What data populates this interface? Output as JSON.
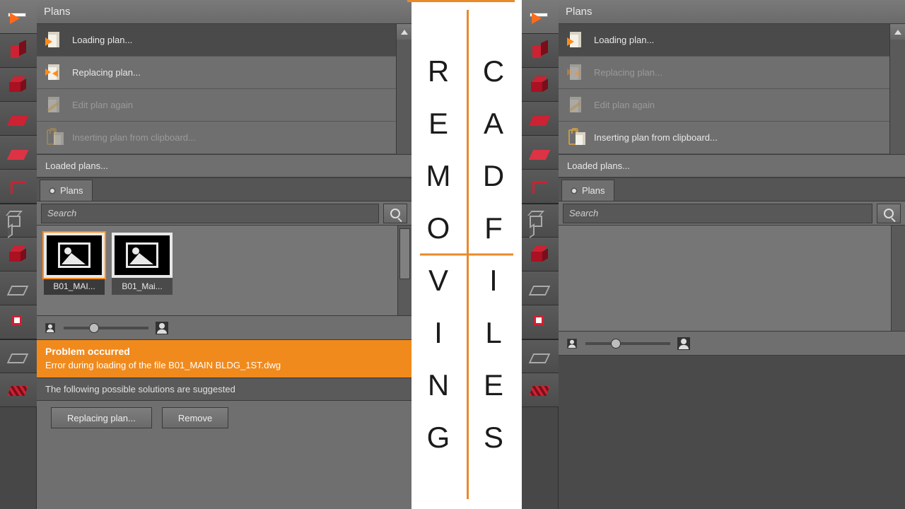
{
  "colors": {
    "accent": "#ff8c1a",
    "error_bg": "#f08a1d"
  },
  "center_text": {
    "left": [
      "R",
      "E",
      "M",
      "O",
      "V",
      "I",
      "N",
      "G"
    ],
    "right": [
      "C",
      "A",
      "D",
      "F",
      "I",
      "L",
      "E",
      "S"
    ]
  },
  "left": {
    "title": "Plans",
    "menu": [
      {
        "label": "Loading plan...",
        "icon": "load",
        "enabled": true,
        "selected": true
      },
      {
        "label": "Replacing plan...",
        "icon": "replace",
        "enabled": true,
        "selected": false
      },
      {
        "label": "Edit plan again",
        "icon": "edit",
        "enabled": false,
        "selected": false
      },
      {
        "label": "Inserting plan from clipboard...",
        "icon": "clipboard",
        "enabled": false,
        "selected": false
      }
    ],
    "loaded_label": "Loaded plans...",
    "tab_label": "Plans",
    "search_placeholder": "Search",
    "thumbs": [
      {
        "caption": "B01_MAI...",
        "selected": true
      },
      {
        "caption": "B01_Mai...",
        "selected": false
      }
    ],
    "slider_pos": 0.3,
    "error": {
      "title": "Problem occurred",
      "detail": "Error during loading of the file B01_MAIN BLDG_1ST.dwg"
    },
    "suggest_label": "The following possible solutions are suggested",
    "buttons": {
      "replace": "Replacing plan...",
      "remove": "Remove"
    },
    "tool_icons": [
      "arrow",
      "walls",
      "redbox",
      "floor",
      "floorw",
      "angle",
      "wirebox",
      "wirebox-red",
      "floorw",
      "marker",
      "floorw",
      "hatch"
    ]
  },
  "right": {
    "title": "Plans",
    "menu": [
      {
        "label": "Loading plan...",
        "icon": "load",
        "enabled": true,
        "selected": true
      },
      {
        "label": "Replacing plan...",
        "icon": "replace",
        "enabled": false,
        "selected": false
      },
      {
        "label": "Edit plan again",
        "icon": "edit",
        "enabled": false,
        "selected": false
      },
      {
        "label": "Inserting plan from clipboard...",
        "icon": "clipboard",
        "enabled": true,
        "selected": false
      }
    ],
    "loaded_label": "Loaded plans...",
    "tab_label": "Plans",
    "search_placeholder": "Search",
    "slider_pos": 0.3,
    "tool_icons": [
      "arrow",
      "walls",
      "redbox",
      "floor",
      "floorw",
      "angle",
      "wirebox",
      "wirebox-red",
      "floorw",
      "marker",
      "floorw",
      "hatch"
    ]
  }
}
